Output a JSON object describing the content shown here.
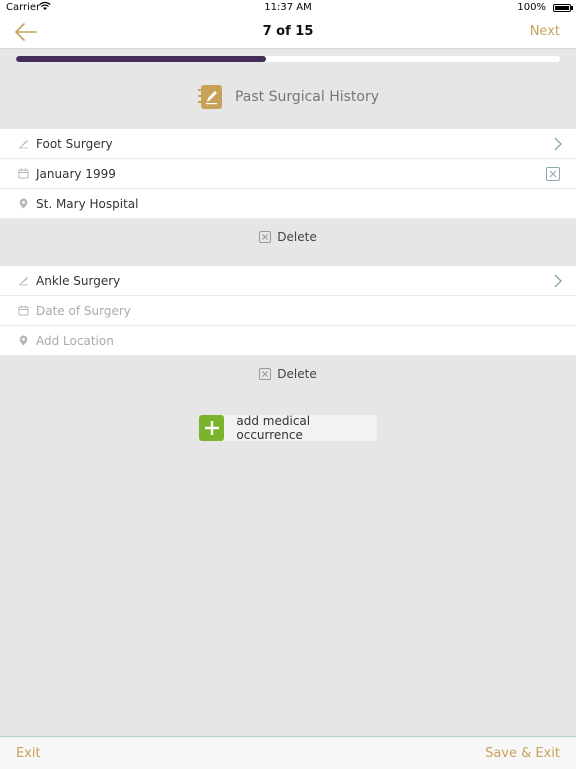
{
  "status_bar": {
    "carrier": "Carrier",
    "time": "11:37 AM",
    "battery": "100%"
  },
  "nav": {
    "title": "7 of 15",
    "next_label": "Next"
  },
  "progress": {
    "fraction": 0.46,
    "color": "#452d5b"
  },
  "section": {
    "title": "Past Surgical History",
    "icon": "notepad-icon"
  },
  "occurrences": [
    {
      "procedure": "Foot Surgery",
      "date": "January 1999",
      "location": "St. Mary Hospital",
      "delete_label": "Delete"
    },
    {
      "procedure": "Ankle Surgery",
      "date_placeholder": "Date of Surgery",
      "location_placeholder": "Add Location",
      "delete_label": "Delete"
    }
  ],
  "add_button": {
    "label": "add medical occurrence"
  },
  "footer": {
    "exit_label": "Exit",
    "save_label": "Save & Exit"
  },
  "colors": {
    "accent": "#c9a25a",
    "add_green": "#7ab32c",
    "background": "#e6e6e6"
  }
}
